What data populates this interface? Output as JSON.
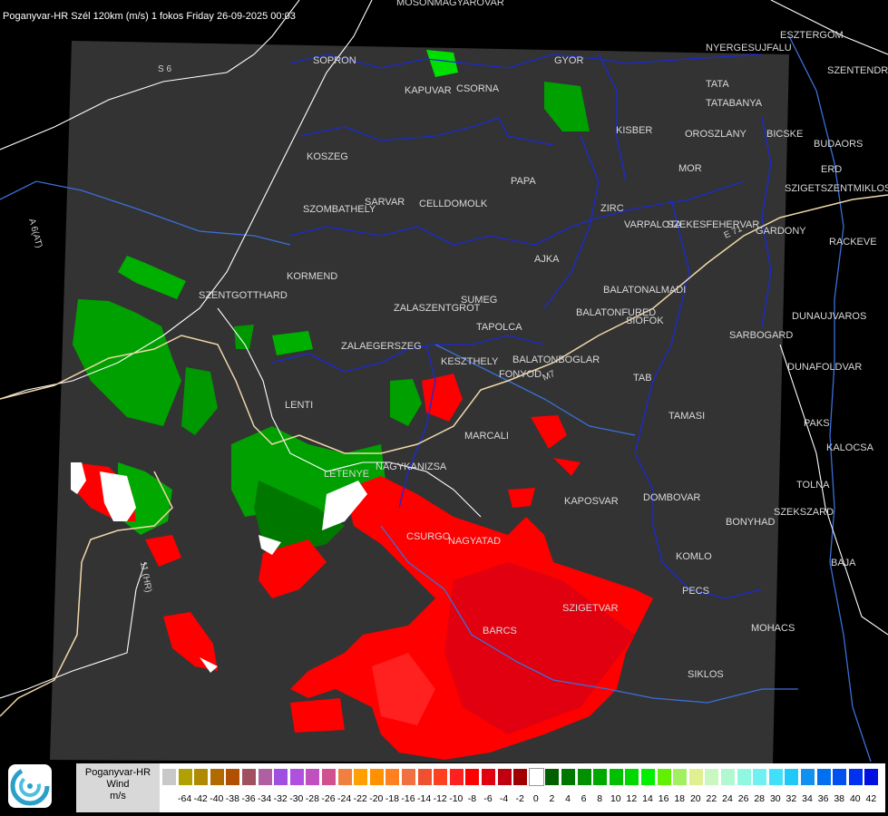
{
  "title": "Poganyvar-HR Szél 120km (m/s) 1 fokos Friday 26-09-2025 00:03",
  "colors": {
    "background": "#000000",
    "coverage": "#333333",
    "roads": "#f0d8a8",
    "border_lines": "#ffffff",
    "rivers": "#3a6fd8",
    "admin_lines": "#1a2ad6",
    "receding": "#ff0000",
    "approaching": "#00a000"
  },
  "cities": [
    {
      "name": "SOPRON"
    },
    {
      "name": "KAPUVAR"
    },
    {
      "name": "CSORNA"
    },
    {
      "name": "GYOR"
    },
    {
      "name": "TATA"
    },
    {
      "name": "TATABANYA"
    },
    {
      "name": "KISBER"
    },
    {
      "name": "OROSZLANY"
    },
    {
      "name": "BICSKE"
    },
    {
      "name": "MOR"
    },
    {
      "name": "KOSZEG"
    },
    {
      "name": "PAPA"
    },
    {
      "name": "SARVAR"
    },
    {
      "name": "CELLDOMOLK"
    },
    {
      "name": "SZOMBATHELY"
    },
    {
      "name": "ZIRC"
    },
    {
      "name": "VARPALOTA"
    },
    {
      "name": "SZEKESFEHERVAR"
    },
    {
      "name": "GARDONY"
    },
    {
      "name": "AJKA"
    },
    {
      "name": "KORMEND"
    },
    {
      "name": "SZENTGOTTHARD"
    },
    {
      "name": "SUMEG"
    },
    {
      "name": "ZALASZENTGROT"
    },
    {
      "name": "BALATONALMADI"
    },
    {
      "name": "BALATONFURED"
    },
    {
      "name": "SIOFOK"
    },
    {
      "name": "TAPOLCA"
    },
    {
      "name": "ZALAEGERSZEG"
    },
    {
      "name": "KESZTHELY"
    },
    {
      "name": "FONYOD"
    },
    {
      "name": "BALATONBOGLAR"
    },
    {
      "name": "LENTI"
    },
    {
      "name": "TAB"
    },
    {
      "name": "TAMASI"
    },
    {
      "name": "MARCALI"
    },
    {
      "name": "LETENYE"
    },
    {
      "name": "NAGYKANIZSA"
    },
    {
      "name": "KAPOSVAR"
    },
    {
      "name": "DOMBOVAR"
    },
    {
      "name": "CSURGO"
    },
    {
      "name": "NAGYATAD"
    },
    {
      "name": "BONYHAD"
    },
    {
      "name": "SZEKSZARD"
    },
    {
      "name": "KOMLO"
    },
    {
      "name": "PECS"
    },
    {
      "name": "SZIGETVAR"
    },
    {
      "name": "BARCS"
    },
    {
      "name": "MOHACS"
    },
    {
      "name": "SIKLOS"
    },
    {
      "name": "BUDAORS"
    },
    {
      "name": "ERD"
    },
    {
      "name": "RACKEVE"
    },
    {
      "name": "SZENTENDRE"
    },
    {
      "name": "ESZTERGOM"
    },
    {
      "name": "DUNAUJVAROS"
    },
    {
      "name": "SARBOGARD"
    },
    {
      "name": "DUNAFOLDVAR"
    },
    {
      "name": "PAKS"
    },
    {
      "name": "KALOCSA"
    },
    {
      "name": "TOLNA"
    },
    {
      "name": "BAJA"
    },
    {
      "name": "NYERGESUJFALU"
    },
    {
      "name": "MOSONMAGYAROVAR"
    },
    {
      "name": "SZIGETSZENTMIKLOS"
    }
  ],
  "roads": [
    {
      "name": "S 6"
    },
    {
      "name": "A 6(AT)"
    },
    {
      "name": "M7"
    },
    {
      "name": "E 71"
    },
    {
      "name": "11 (HR)"
    }
  ],
  "legend": {
    "name": "Poganyvar-HR",
    "quantity": "Wind",
    "unit": "m/s",
    "bins": [
      {
        "label": "",
        "color": "#c8c8c8"
      },
      {
        "label": "-64",
        "color": "#b0a000"
      },
      {
        "label": "-42",
        "color": "#b08a00"
      },
      {
        "label": "-40",
        "color": "#b06a00"
      },
      {
        "label": "-38",
        "color": "#b05000"
      },
      {
        "label": "-36",
        "color": "#a05060"
      },
      {
        "label": "-34",
        "color": "#b060a0"
      },
      {
        "label": "-32",
        "color": "#a050e0"
      },
      {
        "label": "-30",
        "color": "#b050e0"
      },
      {
        "label": "-28",
        "color": "#c050c0"
      },
      {
        "label": "-26",
        "color": "#d05090"
      },
      {
        "label": "-24",
        "color": "#f08040"
      },
      {
        "label": "-22",
        "color": "#ffa000"
      },
      {
        "label": "-20",
        "color": "#ff9000"
      },
      {
        "label": "-18",
        "color": "#ff8020"
      },
      {
        "label": "-16",
        "color": "#f07040"
      },
      {
        "label": "-14",
        "color": "#f05030"
      },
      {
        "label": "-12",
        "color": "#ff4020"
      },
      {
        "label": "-10",
        "color": "#ff2020"
      },
      {
        "label": "-8",
        "color": "#ff0000"
      },
      {
        "label": "-6",
        "color": "#e00010"
      },
      {
        "label": "-4",
        "color": "#c00010"
      },
      {
        "label": "-2",
        "color": "#a00000"
      },
      {
        "label": "0",
        "color": "#ffffff"
      },
      {
        "label": "2",
        "color": "#006000"
      },
      {
        "label": "4",
        "color": "#007800"
      },
      {
        "label": "6",
        "color": "#009000"
      },
      {
        "label": "8",
        "color": "#00a800"
      },
      {
        "label": "10",
        "color": "#00c000"
      },
      {
        "label": "12",
        "color": "#00d800"
      },
      {
        "label": "14",
        "color": "#00f000"
      },
      {
        "label": "16",
        "color": "#60f000"
      },
      {
        "label": "18",
        "color": "#a0f060"
      },
      {
        "label": "20",
        "color": "#e0f090"
      },
      {
        "label": "22",
        "color": "#c8f8c0"
      },
      {
        "label": "24",
        "color": "#b0f8d0"
      },
      {
        "label": "26",
        "color": "#90f8e0"
      },
      {
        "label": "28",
        "color": "#70f0f0"
      },
      {
        "label": "30",
        "color": "#40e0f8"
      },
      {
        "label": "32",
        "color": "#20c8f8"
      },
      {
        "label": "34",
        "color": "#1090f0"
      },
      {
        "label": "36",
        "color": "#0070f0"
      },
      {
        "label": "38",
        "color": "#0050f0"
      },
      {
        "label": "40",
        "color": "#0030f0"
      },
      {
        "label": "42",
        "color": "#0010e0"
      }
    ]
  }
}
